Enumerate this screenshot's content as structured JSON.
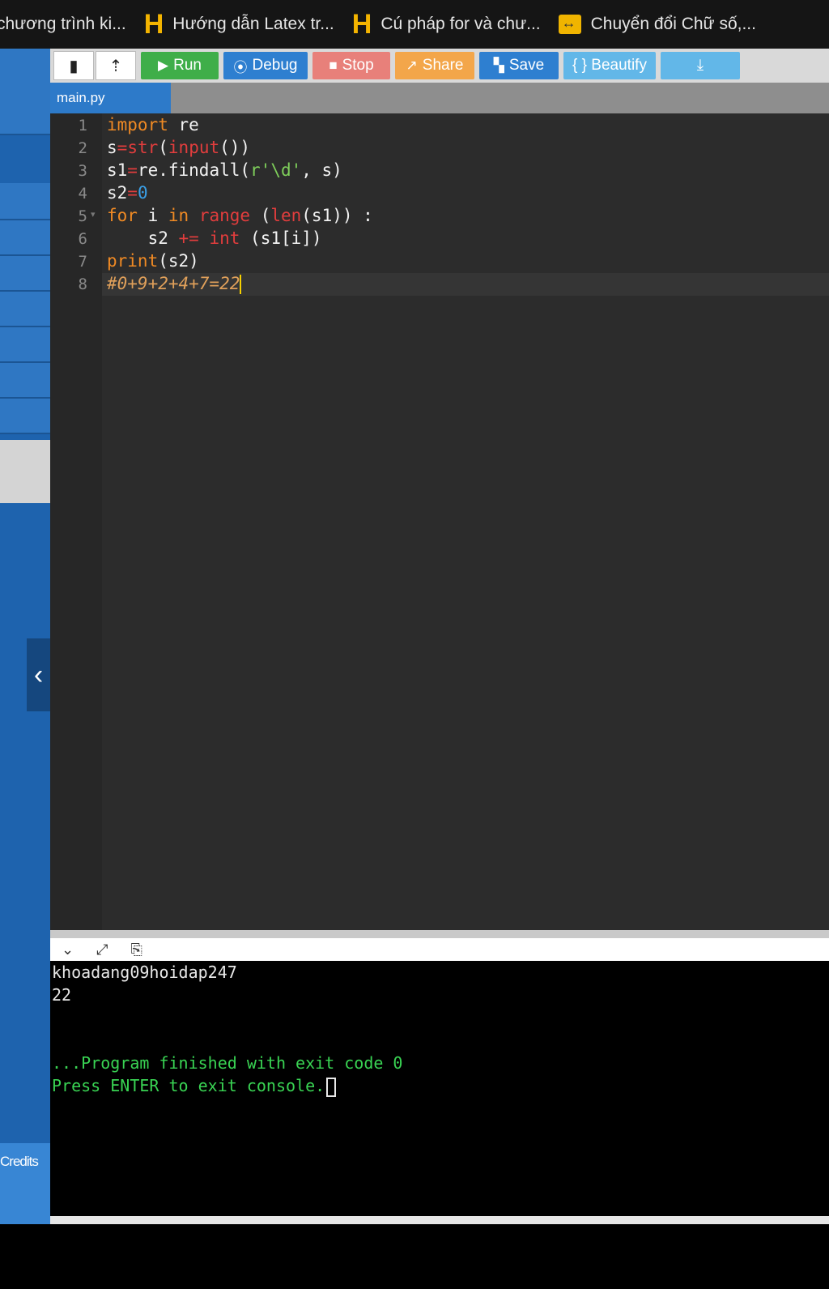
{
  "bookmarks": [
    {
      "label": "chương trình ki...",
      "icon": "none"
    },
    {
      "label": "Hướng dẫn Latex tr...",
      "icon": "hoidap-h-icon"
    },
    {
      "label": "Cú pháp for và chư...",
      "icon": "hoidap-h-icon"
    },
    {
      "label": "Chuyển đổi Chữ số,...",
      "icon": "converter-icon"
    }
  ],
  "toolbar": {
    "run": "Run",
    "debug": "Debug",
    "stop": "Stop",
    "share": "Share",
    "save": "Save",
    "beautify": "{ } Beautify"
  },
  "colors": {
    "run": "#3fae49",
    "debug": "#2e7fd0",
    "stop": "#e8807a",
    "share": "#f3a64a",
    "save": "#2e7fd0",
    "beautify": "#62b7e8",
    "download": "#62b7e8"
  },
  "tab": {
    "filename": "main.py"
  },
  "editor": {
    "line_numbers": [
      "1",
      "2",
      "3",
      "4",
      "5",
      "6",
      "7",
      "8"
    ]
  },
  "console": {
    "input_line": "khoadang09hoidap247",
    "output_line": "22",
    "finished": "...Program finished with exit code 0",
    "press_enter": "Press ENTER to exit console."
  },
  "sidebar": {
    "credits": "Credits"
  }
}
